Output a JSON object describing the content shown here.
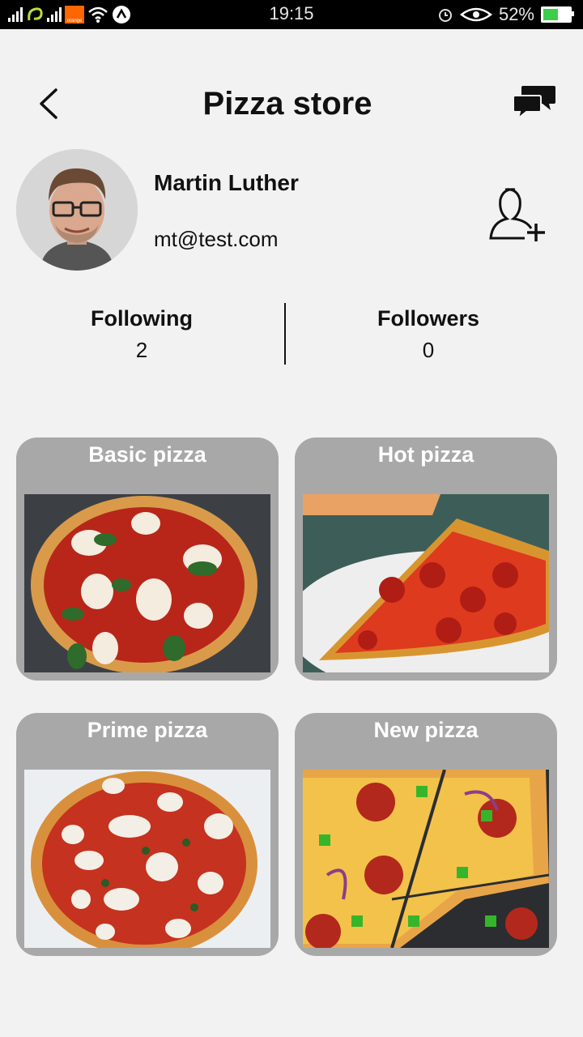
{
  "status_bar": {
    "time": "19:15",
    "battery": "52%",
    "battery_level": 0.52,
    "carrier_badge": "orange"
  },
  "header": {
    "title": "Pizza store",
    "back_icon": "back-chevron-icon",
    "chat_icon": "chat-bubbles-icon"
  },
  "profile": {
    "name": "Martin Luther",
    "email": "mt@test.com",
    "add_icon": "add-user-icon"
  },
  "stats": {
    "following_label": "Following",
    "following_count": "2",
    "followers_label": "Followers",
    "followers_count": "0"
  },
  "products": [
    {
      "title": "Basic pizza"
    },
    {
      "title": "Hot pizza"
    },
    {
      "title": "Prime pizza"
    },
    {
      "title": "New pizza"
    }
  ],
  "colors": {
    "background": "#f2f2f2",
    "card": "#a8a8a8",
    "statusbar": "#000000",
    "battery_fill": "#3ccd4b"
  }
}
